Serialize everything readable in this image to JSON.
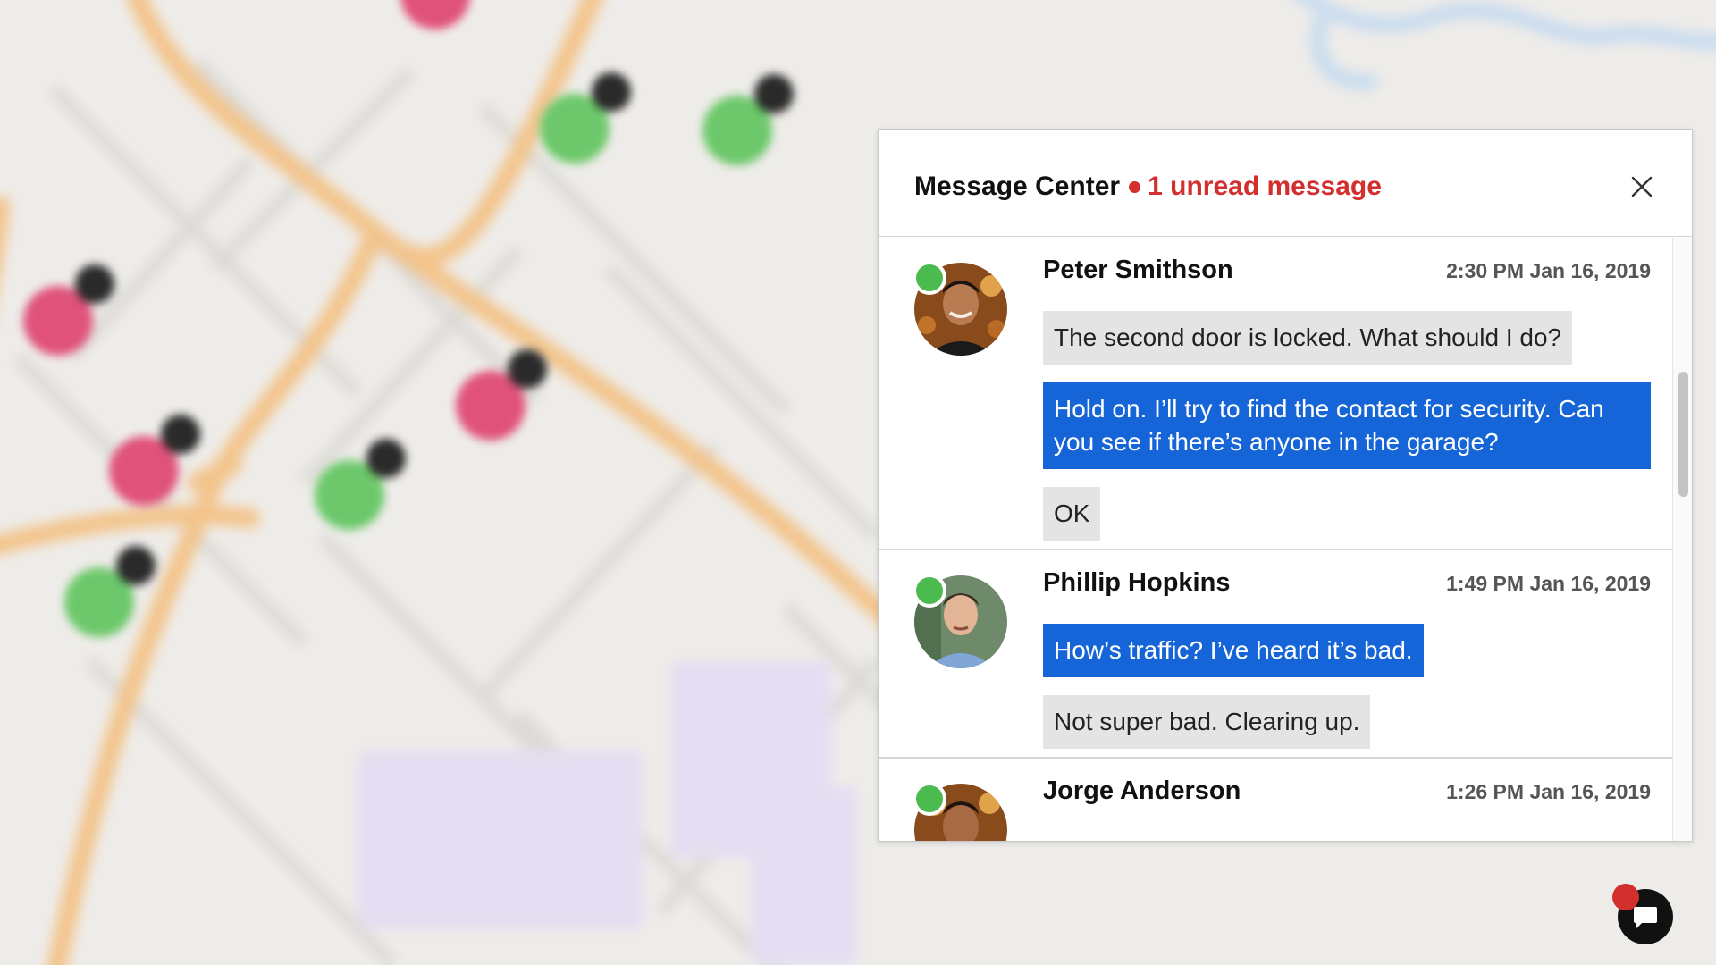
{
  "panel": {
    "title": "Message Center",
    "unread_label": "1 unread message",
    "close_icon": "close-icon"
  },
  "threads": [
    {
      "name": "Peter Smithson",
      "time": "2:30 PM Jan 16, 2019",
      "online": true,
      "messages": [
        {
          "direction": "in",
          "text": "The second door is locked. What should I do?"
        },
        {
          "direction": "out",
          "text": "Hold on. I’ll try to find the contact for security. Can you see if there’s anyone in the garage?"
        },
        {
          "direction": "in",
          "text": "OK"
        }
      ]
    },
    {
      "name": "Phillip Hopkins",
      "time": "1:49 PM Jan 16, 2019",
      "online": true,
      "messages": [
        {
          "direction": "out",
          "text": "How’s traffic? I’ve heard it’s bad."
        },
        {
          "direction": "in",
          "text": "Not super bad. Clearing up."
        }
      ]
    },
    {
      "name": "Jorge Anderson",
      "time": "1:26 PM Jan 16, 2019",
      "online": true,
      "messages": []
    }
  ],
  "colors": {
    "unread": "#d32f2f",
    "outgoing_bubble": "#1565d8",
    "incoming_bubble": "#e4e4e4",
    "presence_online": "#4cbb4f",
    "map_pin_green": "#6cc86a",
    "map_pin_red": "#e0527a"
  },
  "map_pins": [
    {
      "status": "red"
    },
    {
      "status": "green"
    },
    {
      "status": "green"
    },
    {
      "status": "red"
    },
    {
      "status": "red"
    },
    {
      "status": "red"
    },
    {
      "status": "green"
    },
    {
      "status": "green"
    }
  ],
  "chat_fab": {
    "icon": "chat-bubble-icon",
    "has_notification": true
  }
}
